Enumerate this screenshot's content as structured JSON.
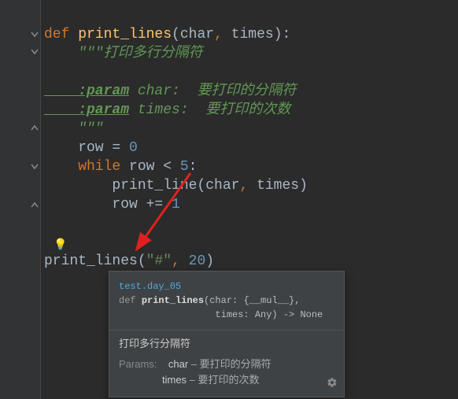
{
  "code": {
    "def": "def ",
    "fn_name": "print_lines",
    "open_paren": "(",
    "param1": "char",
    "comma1": ", ",
    "param2": "times",
    "close_sig": "):",
    "doc_open": "    \"\"\"",
    "doc_summary": "打印多行分隔符",
    "doc_blank": "",
    "doc_tag1": "    :param",
    "doc_p1name": " char: ",
    "doc_p1desc": " 要打印的分隔符",
    "doc_tag2": "    :param",
    "doc_p2name": " times: ",
    "doc_p2desc": " 要打印的次数",
    "doc_close": "    \"\"\"",
    "row_assign_pre": "    row ",
    "eq": "= ",
    "zero": "0",
    "while_kw": "    while ",
    "while_cond": "row < ",
    "five": "5",
    "while_colon": ":",
    "inner_call": "        print_line(",
    "inner_p1": "char",
    "inner_comma": ", ",
    "inner_p2": "times",
    "inner_close": ")",
    "row_inc_pre": "        row ",
    "pluseq": "+= ",
    "one": "1",
    "call_fn": "print_lines",
    "call_open": "(",
    "call_arg1": "\"#\"",
    "call_comma": ", ",
    "call_arg2": "20",
    "call_close": ")"
  },
  "tooltip": {
    "module": "test.day_05",
    "def_kw": "def ",
    "fn": "print_lines",
    "sig1": "(char: {__mul__},",
    "sig2_indent": "                 ",
    "sig2": "times: Any) -> None",
    "summary": "打印多行分隔符",
    "params_label": "Params:",
    "p1_name": "char",
    "p1_sep": " – ",
    "p1_desc": "要打印的分隔符",
    "p2_name": "times",
    "p2_sep": " – ",
    "p2_desc": "要打印的次数"
  }
}
